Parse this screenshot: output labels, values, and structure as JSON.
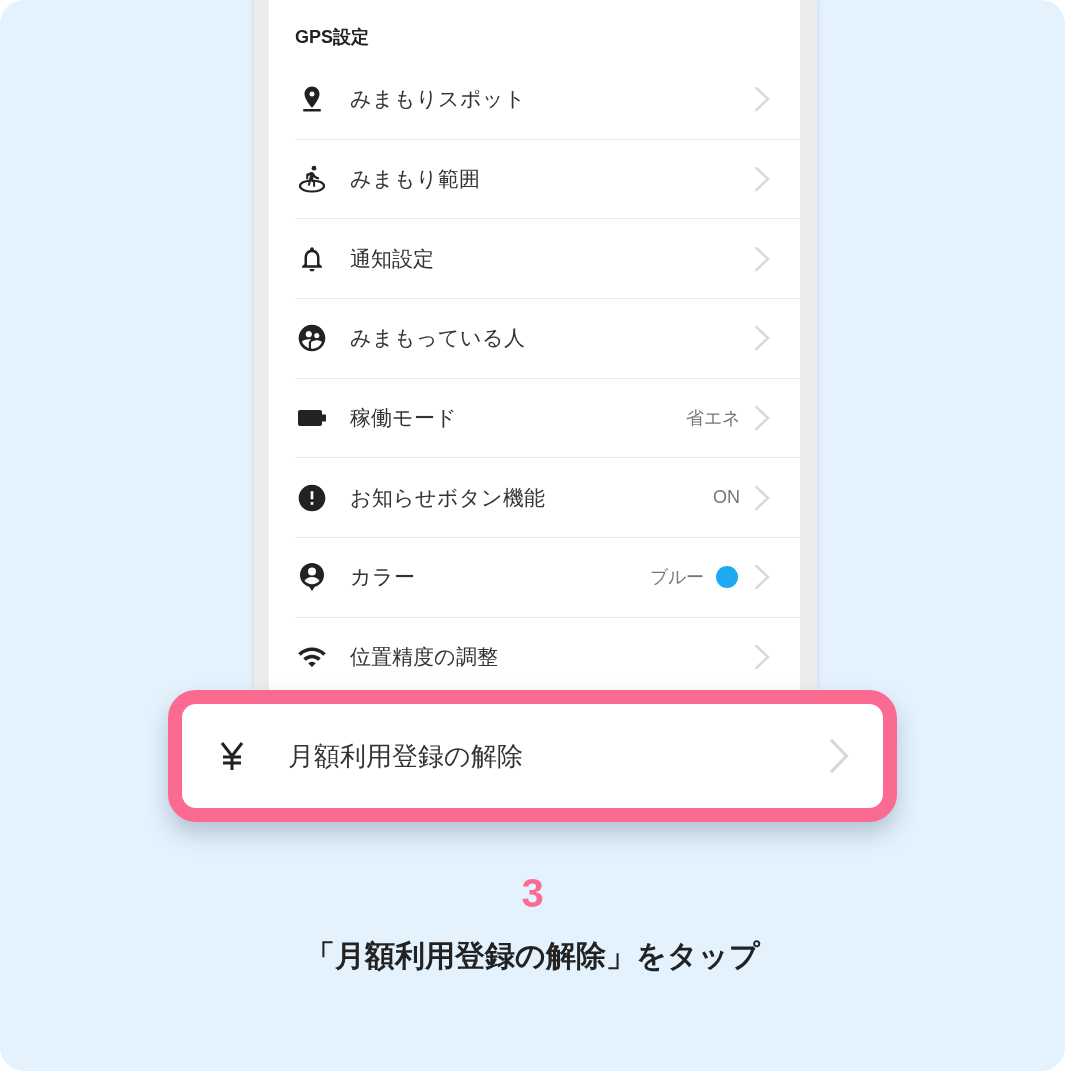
{
  "section_title": "GPS設定",
  "rows": [
    {
      "label": "みまもりスポット"
    },
    {
      "label": "みまもり範囲"
    },
    {
      "label": "通知設定"
    },
    {
      "label": "みまもっている人"
    },
    {
      "label": "稼働モード",
      "value": "省エネ"
    },
    {
      "label": "お知らせボタン機能",
      "value": "ON"
    },
    {
      "label": "カラー",
      "value": "ブルー",
      "color": "#1eaaf0"
    },
    {
      "label": "位置精度の調整"
    }
  ],
  "highlighted_item": {
    "label": "月額利用登録の解除"
  },
  "step": {
    "number": "3",
    "caption": "「月額利用登録の解除」をタップ"
  }
}
